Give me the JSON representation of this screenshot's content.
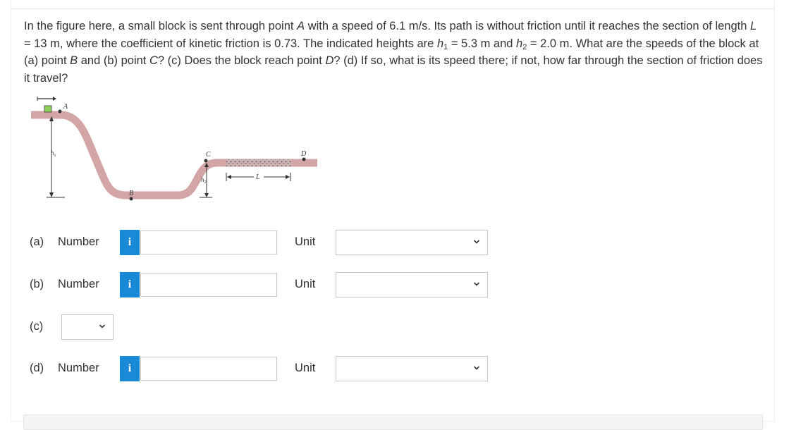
{
  "question": {
    "intro": "In the figure here, a small block is sent through point ",
    "pointA": "A",
    "speed_text": " with a speed of 6.1 m/s. Its path is without friction until it reaches the section of length ",
    "L": "L",
    "L_text": " = 13 m, where the coefficient of kinetic friction is 0.73. The indicated heights are ",
    "h": "h",
    "h1_sub": "1",
    "h1_text": " = 5.3 m and ",
    "h2_sub": "2",
    "h2_text": " = 2.0 m. What are the speeds of the block at ",
    "a_tag": "(a)",
    "a_text": " point ",
    "pointB": "B",
    "and_text": " and ",
    "b_tag": "(b)",
    "b_text": " point ",
    "pointC": "C",
    "q_text": "? ",
    "c_tag": "(c)",
    "c_text": " Does the block reach point ",
    "pointD": "D",
    "q2_text": "? ",
    "d_tag": "(d)",
    "d_text": " If so, what is its speed there; if not, how far through the section of friction does it travel?"
  },
  "figure": {
    "label_A": "A",
    "label_B": "B",
    "label_C": "C",
    "label_D": "D",
    "label_h1": "h",
    "label_h1_sub": "1",
    "label_h2": "h",
    "label_h2_sub": "2",
    "label_L": "L",
    "colors": {
      "track": "#d4a5a5",
      "block": "#8fce5a",
      "friction": "#8a7070"
    }
  },
  "answers": {
    "a": {
      "tag": "(a)",
      "label": "Number",
      "info": "i",
      "value": "",
      "unit_label": "Unit",
      "unit_value": ""
    },
    "b": {
      "tag": "(b)",
      "label": "Number",
      "info": "i",
      "value": "",
      "unit_label": "Unit",
      "unit_value": ""
    },
    "c": {
      "tag": "(c)",
      "value": ""
    },
    "d": {
      "tag": "(d)",
      "label": "Number",
      "info": "i",
      "value": "",
      "unit_label": "Unit",
      "unit_value": ""
    }
  },
  "colors": {
    "info_bg": "#1a8ad8",
    "border": "#c7c7c7"
  }
}
